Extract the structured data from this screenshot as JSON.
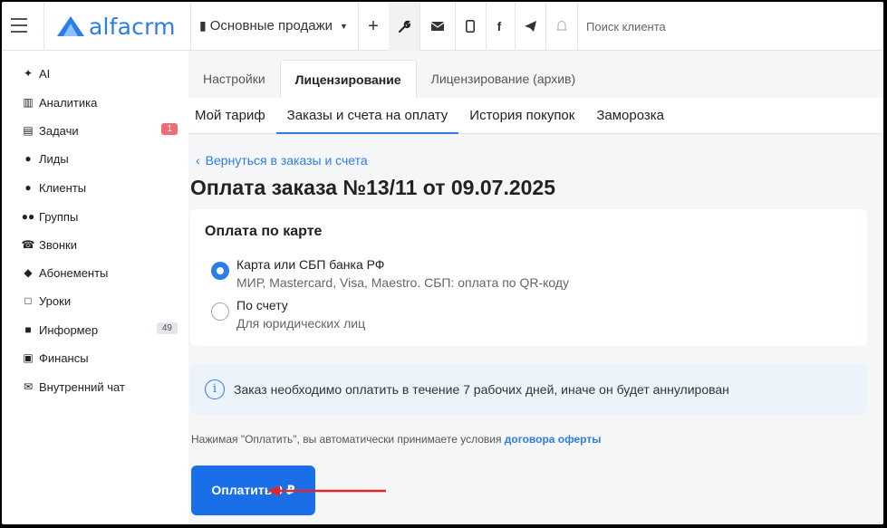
{
  "app": {
    "logo_text": "alfacrm",
    "brand_color": "#2b7de9"
  },
  "topbar": {
    "branch": "Основные продажи",
    "search_placeholder": "Поиск клиента",
    "icons": [
      "plus-icon",
      "wrench-icon",
      "mail-icon",
      "phone-icon",
      "facebook-icon",
      "telegram-icon",
      "bell-icon"
    ]
  },
  "sidebar": {
    "items": [
      {
        "label": "AI",
        "icon": "sparkle-icon"
      },
      {
        "label": "Аналитика",
        "icon": "map-icon"
      },
      {
        "label": "Задачи",
        "icon": "clipboard-icon",
        "badge": "1"
      },
      {
        "label": "Лиды",
        "icon": "user-plus-icon"
      },
      {
        "label": "Клиенты",
        "icon": "user-icon"
      },
      {
        "label": "Группы",
        "icon": "users-icon"
      },
      {
        "label": "Звонки",
        "icon": "phone-icon"
      },
      {
        "label": "Абонементы",
        "icon": "tag-icon"
      },
      {
        "label": "Уроки",
        "icon": "calendar-icon"
      },
      {
        "label": "Информер",
        "icon": "newspaper-icon",
        "badge": "49"
      },
      {
        "label": "Финансы",
        "icon": "money-icon"
      },
      {
        "label": "Внутренний чат",
        "icon": "mail-icon"
      }
    ]
  },
  "main": {
    "tabs_top": [
      "Настройки",
      "Лицензирование",
      "Лицензирование (архив)"
    ],
    "tabs_sub": [
      "Мой тариф",
      "Заказы и счета на оплату",
      "История покупок",
      "Заморозка"
    ],
    "back_link": "Вернуться в заказы и счета",
    "title": "Оплата заказа №13/11 от 09.07.2025",
    "card": {
      "title": "Оплата по карте",
      "options": [
        {
          "title": "Карта или СБП банка РФ",
          "subtitle": "МИР, Mastercard, Visa, Maestro. СБП: оплата по QR-коду",
          "selected": true
        },
        {
          "title": "По счету",
          "subtitle": "Для юридических лиц",
          "selected": false
        }
      ]
    },
    "notice": "Заказ необходимо оплатить в течение 7 рабочих дней, иначе он будет аннулирован",
    "terms_prefix": "Нажимая \"Оплатить\", вы автоматически принимаете условия ",
    "terms_link": "договора оферты",
    "pay_button": "Оплатить 0 ₽"
  }
}
